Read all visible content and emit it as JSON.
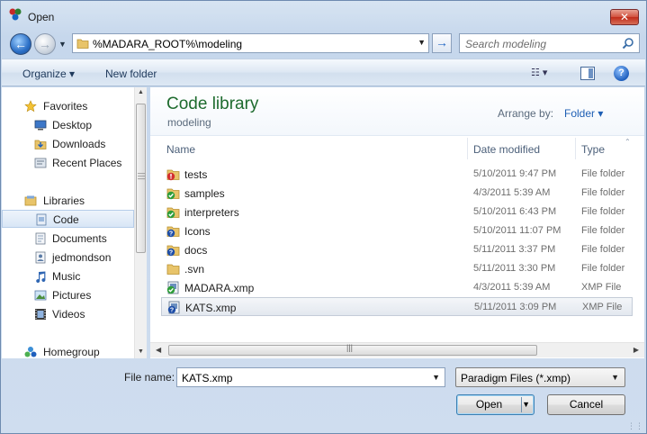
{
  "window": {
    "title": "Open",
    "close_label": "✕"
  },
  "address_bar": {
    "path": "%MADARA_ROOT%\\modeling",
    "search_placeholder": "Search modeling"
  },
  "toolbar": {
    "organize_label": "Organize ▾",
    "new_folder_label": "New folder",
    "views_label": "☷ ▾",
    "help_label": "?"
  },
  "nav": {
    "favorites_label": "Favorites",
    "favorites": [
      {
        "label": "Desktop",
        "icon": "desktop-icon"
      },
      {
        "label": "Downloads",
        "icon": "downloads-icon"
      },
      {
        "label": "Recent Places",
        "icon": "recent-places-icon"
      }
    ],
    "libraries_label": "Libraries",
    "libraries": [
      {
        "label": "Code",
        "icon": "library-icon",
        "selected": true
      },
      {
        "label": "Documents",
        "icon": "documents-icon"
      },
      {
        "label": "jedmondson",
        "icon": "user-folder-icon"
      },
      {
        "label": "Music",
        "icon": "music-icon"
      },
      {
        "label": "Pictures",
        "icon": "pictures-icon"
      },
      {
        "label": "Videos",
        "icon": "videos-icon"
      }
    ],
    "homegroup_label": "Homegroup"
  },
  "library": {
    "title": "Code library",
    "subtitle": "modeling",
    "arrange_by_label": "Arrange by:",
    "arrange_by_value": "Folder ▾"
  },
  "columns": {
    "name": "Name",
    "date": "Date modified",
    "type": "Type"
  },
  "files": [
    {
      "name": "tests",
      "date": "5/10/2011 9:47 PM",
      "type": "File folder",
      "overlay": "error",
      "selected": false
    },
    {
      "name": "samples",
      "date": "4/3/2011 5:39 AM",
      "type": "File folder",
      "overlay": "ok",
      "selected": false
    },
    {
      "name": "interpreters",
      "date": "5/10/2011 6:43 PM",
      "type": "File folder",
      "overlay": "ok",
      "selected": false
    },
    {
      "name": "Icons",
      "date": "5/10/2011 11:07 PM",
      "type": "File folder",
      "overlay": "question",
      "selected": false
    },
    {
      "name": "docs",
      "date": "5/11/2011 3:37 PM",
      "type": "File folder",
      "overlay": "question",
      "selected": false
    },
    {
      "name": ".svn",
      "date": "5/11/2011 3:30 PM",
      "type": "File folder",
      "overlay": "none",
      "selected": false
    },
    {
      "name": "MADARA.xmp",
      "date": "4/3/2011 5:39 AM",
      "type": "XMP File",
      "overlay": "ok-file",
      "selected": false
    },
    {
      "name": "KATS.xmp",
      "date": "5/11/2011 3:09 PM",
      "type": "XMP File",
      "overlay": "question-file",
      "selected": true
    }
  ],
  "bottom": {
    "file_name_label": "File name:",
    "file_name_value": "KATS.xmp",
    "filter_value": "Paradigm Files (*.xmp)",
    "open_label": "Open",
    "cancel_label": "Cancel"
  },
  "colors": {
    "library_title": "#1e6b2e",
    "link_blue": "#1e5fb4",
    "selection_border": "#b6cde9"
  }
}
